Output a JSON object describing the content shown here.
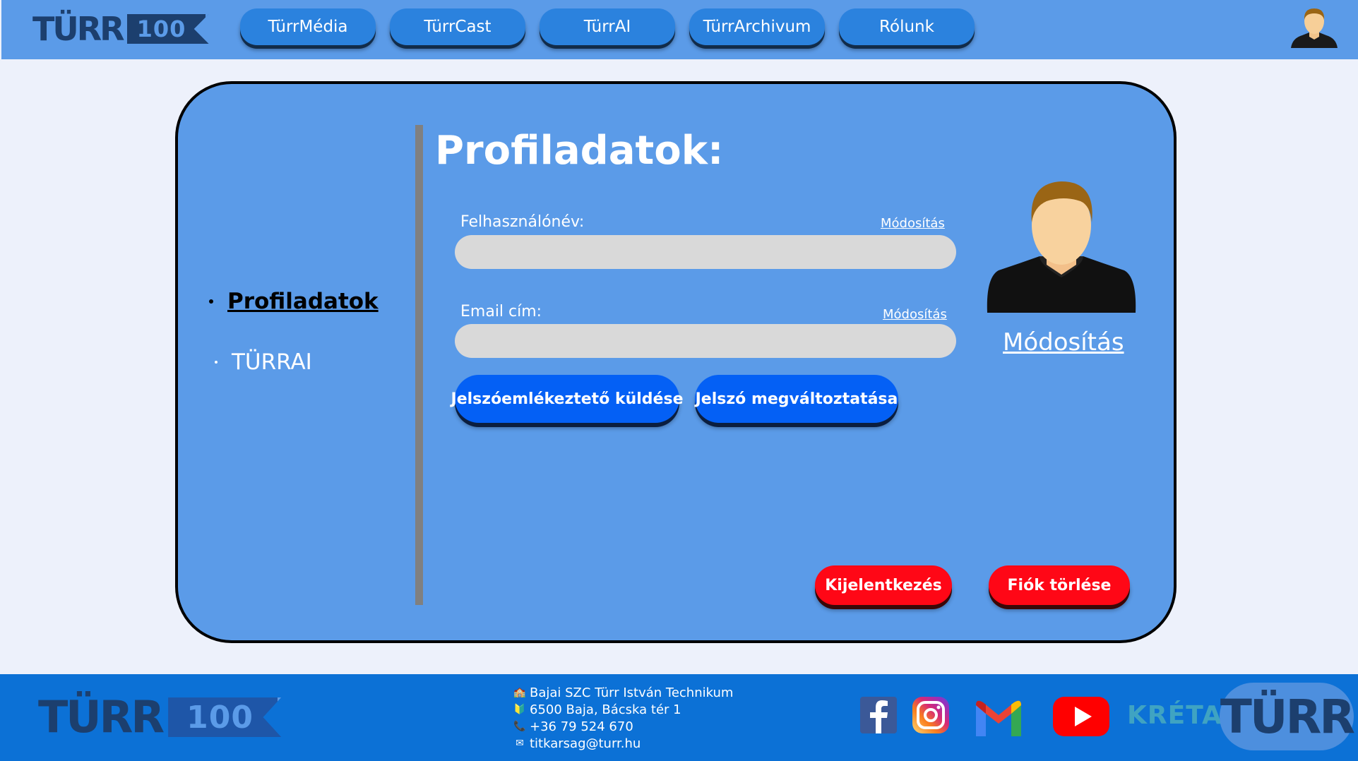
{
  "header": {
    "logo": {
      "wordmark": "TÜRR",
      "badge": "100"
    },
    "nav": [
      {
        "label": "TürrMédia"
      },
      {
        "label": "TürrCast"
      },
      {
        "label": "TürrAI"
      },
      {
        "label": "TürrArchivum"
      },
      {
        "label": "Rólunk"
      }
    ],
    "avatar_icon": "user-avatar-icon"
  },
  "sidebar": {
    "items": [
      {
        "label": "Profiladatok",
        "active": true
      },
      {
        "label": "TÜRRAI",
        "active": false
      }
    ]
  },
  "profile": {
    "title": "Profiladatok:",
    "username": {
      "label": "Felhasználónév:",
      "edit_label": "Módosítás",
      "value": ""
    },
    "email": {
      "label": "Email cím:",
      "edit_label": "Módosítás",
      "value": ""
    },
    "send_reminder_label": "Jelszóemlékeztető küldése",
    "change_password_label": "Jelszó megváltoztatása",
    "avatar_edit_label": "Módosítás",
    "logout_label": "Kijelentkezés",
    "delete_account_label": "Fiók törlése"
  },
  "footer": {
    "logo": {
      "wordmark": "TÜRR",
      "badge": "100"
    },
    "contact": [
      {
        "icon": "school-icon",
        "glyph": "🏫",
        "text": "Bajai SZC Türr István Technikum"
      },
      {
        "icon": "location-icon",
        "glyph": "🔰",
        "text": "6500 Baja, Bácska tér 1"
      },
      {
        "icon": "phone-icon",
        "glyph": "📞",
        "text": "+36 79 524 670"
      },
      {
        "icon": "mail-icon",
        "glyph": "✉",
        "text": "titkarsag@turr.hu"
      }
    ],
    "social": [
      "facebook-icon",
      "instagram-icon",
      "gmail-icon",
      "youtube-icon"
    ],
    "kreta": "KRÉTA",
    "badge_wordmark": "TÜRR"
  },
  "colors": {
    "header_bg": "#5b9be8",
    "page_bg": "#edf1fb",
    "card_bg": "#5b9be8",
    "nav_button": "#2b82de",
    "primary_button": "#0460f5",
    "danger_button": "#ff0716",
    "footer_bg": "#0c71d6",
    "logo_dark": "#1c3f6e"
  }
}
